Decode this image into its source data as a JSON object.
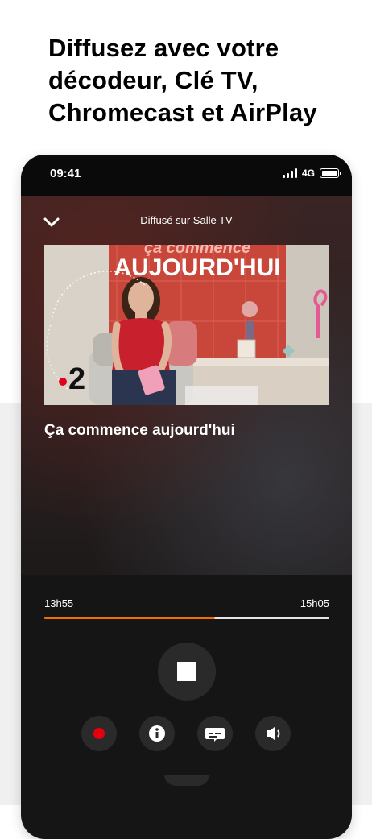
{
  "headline": {
    "line1": "Diffusez avec votre",
    "line2": "décodeur, Clé TV,",
    "line3": "Chromecast et AirPlay"
  },
  "status_bar": {
    "time": "09:41",
    "network": "4G"
  },
  "player": {
    "cast_label": "Diffusé sur Salle TV",
    "thumbnail": {
      "show_banner": "AUJOURD'HUI",
      "channel_number": "2"
    },
    "program_title": "Ça commence aujourd'hui",
    "start_time": "13h55",
    "end_time": "15h05",
    "progress": 0.6
  },
  "colors": {
    "accent_orange": "#f16e00",
    "record_red": "#e3000f",
    "channel_dot": "#e2001a"
  },
  "icons": {
    "collapse": "chevron-down-icon",
    "stop": "stop-icon",
    "record": "record-icon",
    "info": "info-icon",
    "subtitles": "subtitles-icon",
    "volume": "volume-icon"
  }
}
